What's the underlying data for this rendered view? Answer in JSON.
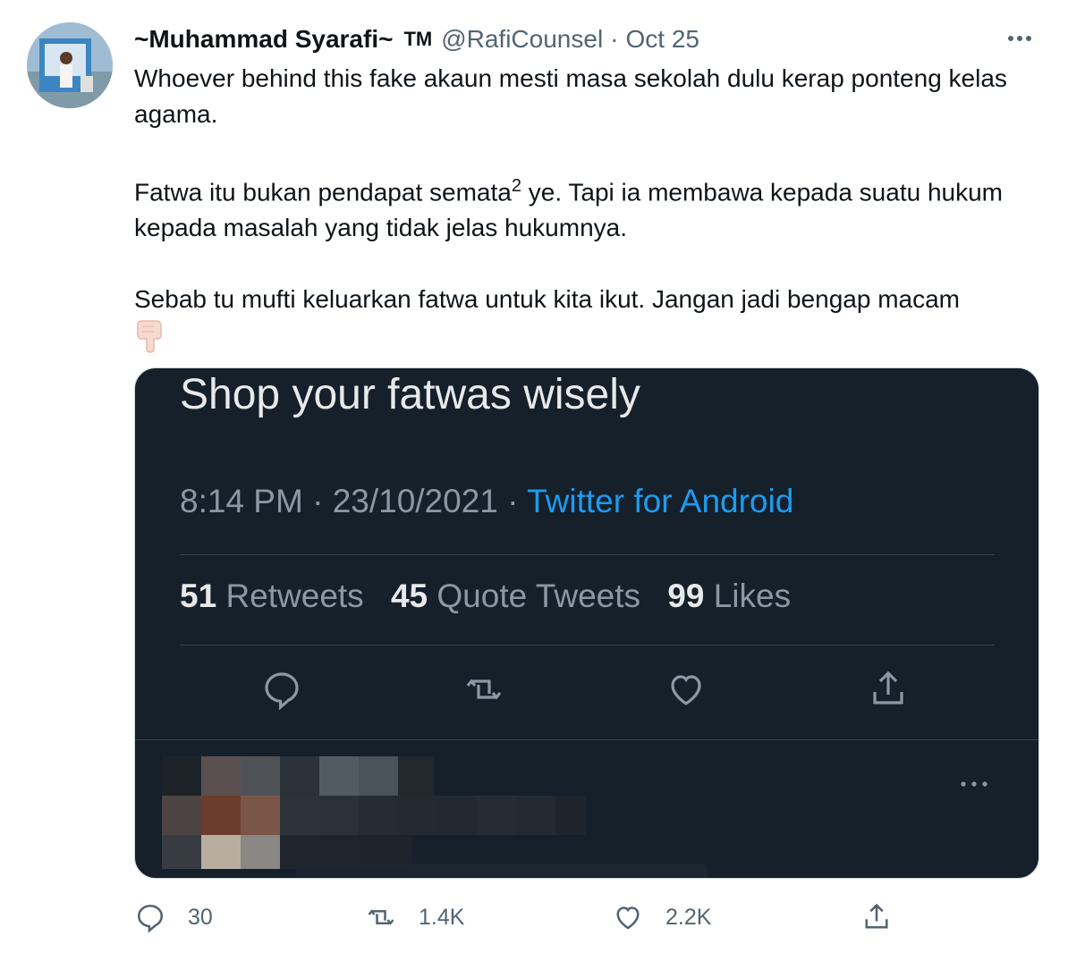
{
  "tweet": {
    "display_name": "~Muhammad Syarafi~",
    "badge": "TM",
    "handle": "@RafiCounsel",
    "separator": "·",
    "date": "Oct 25",
    "text": {
      "p1": "Whoever behind this fake akaun mesti masa sekolah dulu kerap ponteng kelas agama.",
      "p2_a": "Fatwa itu bukan pendapat semata",
      "p2_sup": "2",
      "p2_b": " ye. Tapi ia membawa kepada suatu hukum  kepada masalah yang tidak jelas hukumnya.",
      "p3": "Sebab tu mufti keluarkan fatwa untuk kita ikut. Jangan jadi bengap macam"
    },
    "emoji": "pointing-down-emoji",
    "actions": {
      "reply_count": "30",
      "retweet_count": "1.4K",
      "like_count": "2.2K"
    }
  },
  "embedded_screenshot": {
    "tweet_text": "Shop your fatwas wisely",
    "time": "8:14 PM",
    "sep": "·",
    "date": "23/10/2021",
    "source": "Twitter for Android",
    "retweets_count": "51",
    "retweets_label": "Retweets",
    "quotes_count": "45",
    "quotes_label": "Quote Tweets",
    "likes_count": "99",
    "likes_label": "Likes"
  },
  "colors": {
    "accent": "#1d9bf0",
    "secondary_text": "#536471",
    "dark_bg": "#15202b"
  }
}
